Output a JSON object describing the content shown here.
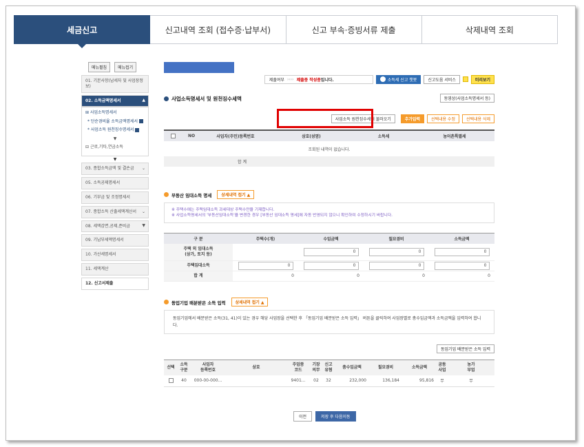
{
  "top_tabs": [
    {
      "label": "세금신고",
      "active": true
    },
    {
      "label": "신고내역 조회 (접수증·납부서)"
    },
    {
      "label": "신고 부속·증빙서류 제출"
    },
    {
      "label": "삭제내역 조회"
    }
  ],
  "sidebar": {
    "expand_all": "메뉴펼침",
    "collapse_all": "메뉴접기",
    "items": [
      {
        "label": "01. 기본사항(납세자 및 사업장정보)"
      },
      {
        "label": "02. 소득금액명세서"
      },
      {
        "label": "03. 종합소득금액 및 결손금"
      },
      {
        "label": "05. 소득공제명세서"
      },
      {
        "label": "06. 기부금 및 조정명세서"
      },
      {
        "label": "07. 종합소득 산출세액계산서"
      },
      {
        "label": "08. 세액감면,공제,준비금"
      },
      {
        "label": "09. 기납부세액명세서"
      },
      {
        "label": "10. 가산세명세서"
      },
      {
        "label": "11. 세액계산"
      },
      {
        "label": "12. 신고서제출"
      }
    ],
    "sub": {
      "group": "사업소득명세서",
      "item1": "* 단순경비율 소득금액명세서",
      "item2": "* 사업소득 원천징수명세서",
      "other": "근로,기타,연금소득"
    }
  },
  "toolbar": {
    "status_label": "제출여부",
    "status_arrows": "››››",
    "status_red": "제출중 작성중",
    "status_suffix": "입니다.",
    "chatbot": "소득세 신고 챗봇",
    "guide": "신고도움 서비스",
    "preview": "미리보기"
  },
  "section1": {
    "title": "사업소득명세서 및 원천징수세액",
    "video_btn": "동영상(사업소득명세서 등)",
    "import_btn": "사업소득 원천징수세액 불러오기",
    "add_btn": "추가입력",
    "edit_btn": "선택내용 수정",
    "delete_btn": "선택내용 삭제",
    "columns": [
      "NO",
      "사업자(주민)등록번호",
      "상호(성명)",
      "소득세",
      "농어촌특별세"
    ],
    "empty_msg": "조회된 내역이 없습니다.",
    "total_label": "합 계"
  },
  "section2": {
    "title": "부동산 임대소득 명세",
    "collapse_btn": "상세내역 접기 ▲",
    "notes": [
      "※ 주택수에는 주택임대소득 과세대상 주택수만을 기재합니다.",
      "※ 사업소득명세서의 '부동산임대소득'을 변경한 경우 [부동산 임대소득 명세]에 자동 반영되지 않으니 확인하여 수정하시기 바랍니다."
    ],
    "columns": [
      "구 분",
      "주택수(개)",
      "수입금액",
      "필요경비",
      "소득금액"
    ],
    "rows": [
      {
        "label": "주택 외 임대소득\n(상가, 토지 등)",
        "house": "",
        "revenue": "0",
        "expense": "0",
        "income": "0"
      },
      {
        "label": "주택임대소득",
        "house": "0",
        "revenue": "0",
        "expense": "0",
        "income": "0"
      },
      {
        "label": "합 계",
        "house": "0",
        "revenue": "0",
        "expense": "0",
        "income": "0"
      }
    ]
  },
  "section3": {
    "title": "동업기업 배분받은 소득 입력",
    "collapse_btn": "상세내역 접기 ▲",
    "note": "동업기업에서 배분받은 소득(31, 41)이 있는 경우 해당 사업장을 선택한 후 「동업기업 배분받은 소득 입력」 버튼을 클릭하여 사업장별로 총수입금액과 소득금액을 입력하여 합니다.",
    "input_btn": "동업기업 배분받은 소득 입력",
    "columns": [
      "선택",
      "소득\n구분",
      "사업자\n등록번호",
      "상호",
      "주업종\n코드",
      "기장\n의무",
      "신고\n유형",
      "총수입금액",
      "필요경비",
      "소득금액",
      "공동\n사업",
      "농가\n부업"
    ],
    "rows": [
      {
        "type": "40",
        "reg": "000-00-000...",
        "name": "",
        "code": "9401...",
        "duty": "02",
        "report": "32",
        "revenue": "232,000",
        "expense": "136,184",
        "income": "95,816",
        "joint": "무",
        "farm": "무"
      }
    ]
  },
  "nav": {
    "prev": "이전",
    "next": "저장 후 다음이동"
  }
}
